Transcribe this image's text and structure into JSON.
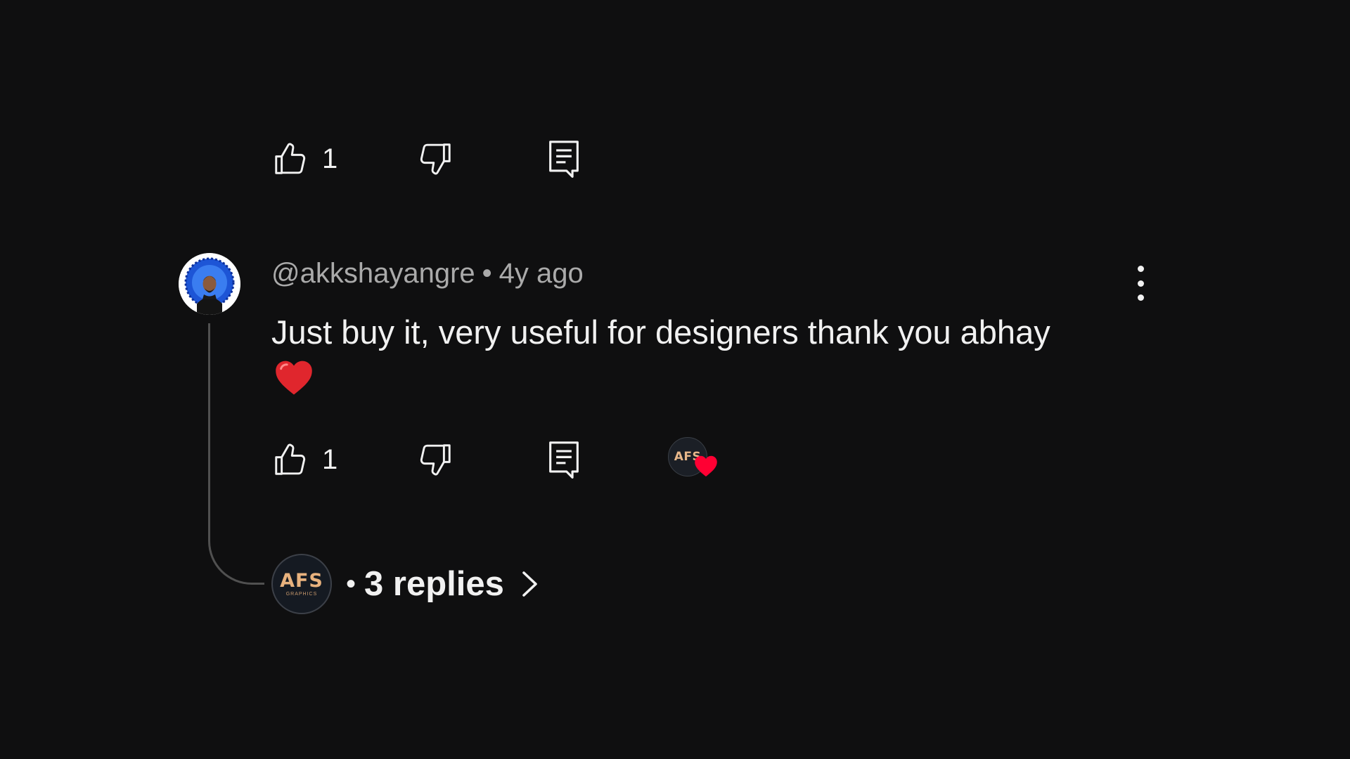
{
  "top_actions": {
    "like_count": "1"
  },
  "comment": {
    "handle": "@akkshayangre",
    "separator": "•",
    "time": "4y ago",
    "text": "Just buy it, very useful for designers thank you abhay",
    "emoji": "heart-emoji",
    "like_count": "1",
    "creator_avatar_text": "AFS",
    "avatar_icon": "profile-photo"
  },
  "replies": {
    "avatar_text": "AFS",
    "avatar_subtext": "GRAPHICS",
    "bullet": "•",
    "label": "3 replies",
    "chevron_icon": "chevron-right-icon"
  },
  "colors": {
    "background": "#0f0f10",
    "primary_text": "#f1f1f1",
    "secondary_text": "#aaaaaa",
    "heart_red": "#ff0033",
    "thread_line": "#505050",
    "afs_gold": "#e8b27e"
  }
}
